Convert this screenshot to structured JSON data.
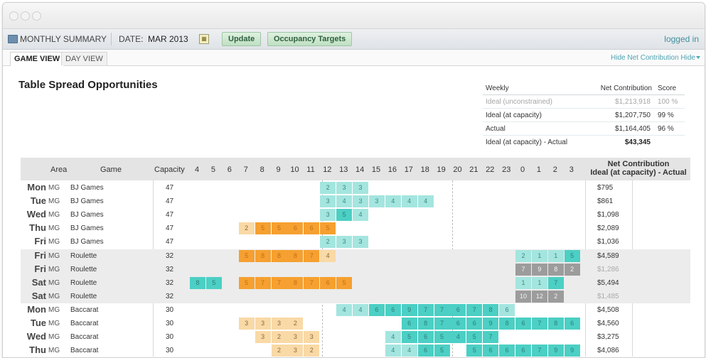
{
  "toolbar": {
    "monthly_summary": "MONTHLY SUMMARY",
    "date_label": "DATE:",
    "date_value": "MAR 2013",
    "update_label": "Update",
    "occupancy_label": "Occupancy Targets",
    "logged_in": "logged in"
  },
  "tabs": [
    {
      "label": "GAME VIEW",
      "active": true
    },
    {
      "label": "DAY VIEW",
      "active": false
    }
  ],
  "hide_links": {
    "hide_net": "Hide Net Contribution",
    "hide": "Hide"
  },
  "title": "Table Spread Opportunities",
  "summary": {
    "headers": [
      "Weekly",
      "Net Contribution",
      "Score"
    ],
    "rows": [
      {
        "label": "Ideal (unconstrained)",
        "value": "$1,213,918",
        "score": "100 %",
        "muted": true
      },
      {
        "label": "Ideal (at capacity)",
        "value": "$1,207,750",
        "score": "99 %",
        "muted": false
      },
      {
        "label": "Actual",
        "value": "$1,164,405",
        "score": "96 %",
        "muted": false
      }
    ],
    "total_label": "Ideal (at capacity) - Actual",
    "total_value": "$43,345"
  },
  "grid": {
    "headers": {
      "area": "Area",
      "game": "Game",
      "capacity": "Capacity",
      "net_line1": "Net Contribution",
      "net_line2": "Ideal (at capacity) - Actual"
    },
    "hours": [
      "4",
      "5",
      "6",
      "7",
      "8",
      "9",
      "10",
      "11",
      "12",
      "13",
      "14",
      "15",
      "16",
      "17",
      "18",
      "19",
      "20",
      "21",
      "22",
      "23",
      "0",
      "1",
      "2",
      "3"
    ],
    "colors": {
      "teal": "#4ccfc4",
      "light_teal": "#a4e5df",
      "orange": "#f5a030",
      "light_orange": "#f9d9a6",
      "gray": "#9c9c9c",
      "light_gray": "#bcbcbc"
    },
    "rows": [
      {
        "day": "Mon",
        "area": "MG",
        "game": "BJ Games",
        "capacity": "47",
        "net": "$795",
        "shade": false,
        "dim": false,
        "cells": [
          [
            8,
            "2",
            "lt"
          ],
          [
            9,
            "3",
            "lt"
          ],
          [
            10,
            "3",
            "lt"
          ]
        ]
      },
      {
        "day": "Tue",
        "area": "MG",
        "game": "BJ Games",
        "capacity": "47",
        "net": "$861",
        "shade": false,
        "dim": false,
        "cells": [
          [
            8,
            "3",
            "lt"
          ],
          [
            9,
            "4",
            "lt"
          ],
          [
            10,
            "3",
            "lt"
          ],
          [
            11,
            "3",
            "lt"
          ],
          [
            12,
            "4",
            "lt"
          ],
          [
            13,
            "4",
            "lt"
          ],
          [
            14,
            "4",
            "lt"
          ]
        ]
      },
      {
        "day": "Wed",
        "area": "MG",
        "game": "BJ Games",
        "capacity": "47",
        "net": "$1,098",
        "shade": false,
        "dim": false,
        "cells": [
          [
            8,
            "3",
            "lt"
          ],
          [
            9,
            "5",
            "t"
          ],
          [
            10,
            "4",
            "lt"
          ]
        ]
      },
      {
        "day": "Thu",
        "area": "MG",
        "game": "BJ Games",
        "capacity": "47",
        "net": "$2,089",
        "shade": false,
        "dim": false,
        "cells": [
          [
            3,
            "2",
            "lo"
          ],
          [
            4,
            "5",
            "o"
          ],
          [
            5,
            "5",
            "o"
          ],
          [
            6,
            "6",
            "o"
          ],
          [
            7,
            "6",
            "o"
          ],
          [
            8,
            "5",
            "o"
          ]
        ]
      },
      {
        "day": "Fri",
        "area": "MG",
        "game": "BJ Games",
        "capacity": "47",
        "net": "$1,036",
        "shade": false,
        "dim": false,
        "cells": [
          [
            8,
            "2",
            "lt"
          ],
          [
            9,
            "3",
            "lt"
          ],
          [
            10,
            "3",
            "lt"
          ]
        ]
      },
      {
        "day": "Fri",
        "area": "MG",
        "game": "Roulette",
        "capacity": "32",
        "net": "$4,589",
        "shade": true,
        "dim": false,
        "cells": [
          [
            3,
            "5",
            "o"
          ],
          [
            4,
            "8",
            "o"
          ],
          [
            5,
            "8",
            "o"
          ],
          [
            6,
            "8",
            "o"
          ],
          [
            7,
            "7",
            "o"
          ],
          [
            8,
            "4",
            "lo"
          ],
          [
            20,
            "2",
            "lt"
          ],
          [
            21,
            "1",
            "lt"
          ],
          [
            22,
            "1",
            "lt"
          ],
          [
            23,
            "5",
            "t"
          ]
        ]
      },
      {
        "day": "Fri",
        "area": "MG",
        "game": "Roulette",
        "capacity": "32",
        "net": "$1,286",
        "shade": true,
        "dim": true,
        "cells": [
          [
            20,
            "7",
            "g"
          ],
          [
            21,
            "9",
            "g"
          ],
          [
            22,
            "8",
            "g"
          ],
          [
            23,
            "2",
            "g"
          ]
        ]
      },
      {
        "day": "Sat",
        "area": "MG",
        "game": "Roulette",
        "capacity": "32",
        "net": "$5,494",
        "shade": true,
        "dim": false,
        "cells": [
          [
            0,
            "8",
            "t"
          ],
          [
            1,
            "5",
            "t"
          ],
          [
            3,
            "5",
            "o"
          ],
          [
            4,
            "7",
            "o"
          ],
          [
            5,
            "7",
            "o"
          ],
          [
            6,
            "8",
            "o"
          ],
          [
            7,
            "7",
            "o"
          ],
          [
            8,
            "6",
            "o"
          ],
          [
            9,
            "5",
            "o"
          ],
          [
            20,
            "1",
            "lt"
          ],
          [
            21,
            "1",
            "lt"
          ],
          [
            22,
            "7",
            "t"
          ]
        ]
      },
      {
        "day": "Sat",
        "area": "MG",
        "game": "Roulette",
        "capacity": "32",
        "net": "$1,485",
        "shade": true,
        "dim": true,
        "cells": [
          [
            20,
            "10",
            "g"
          ],
          [
            21,
            "12",
            "g"
          ],
          [
            22,
            "2",
            "g"
          ]
        ]
      },
      {
        "day": "Mon",
        "area": "MG",
        "game": "Baccarat",
        "capacity": "30",
        "net": "$4,508",
        "shade": false,
        "dim": false,
        "cells": [
          [
            9,
            "4",
            "lt"
          ],
          [
            10,
            "4",
            "lt"
          ],
          [
            11,
            "6",
            "t"
          ],
          [
            12,
            "6",
            "t"
          ],
          [
            13,
            "9",
            "t"
          ],
          [
            14,
            "7",
            "t"
          ],
          [
            15,
            "7",
            "t"
          ],
          [
            16,
            "6",
            "t"
          ],
          [
            17,
            "7",
            "t"
          ],
          [
            18,
            "8",
            "t"
          ],
          [
            19,
            "6",
            "lt"
          ]
        ]
      },
      {
        "day": "Tue",
        "area": "MG",
        "game": "Baccarat",
        "capacity": "30",
        "net": "$4,560",
        "shade": false,
        "dim": false,
        "cells": [
          [
            3,
            "3",
            "lo"
          ],
          [
            4,
            "3",
            "lo"
          ],
          [
            5,
            "3",
            "lo"
          ],
          [
            6,
            "2",
            "lo"
          ],
          [
            13,
            "6",
            "t"
          ],
          [
            14,
            "8",
            "t"
          ],
          [
            15,
            "7",
            "t"
          ],
          [
            16,
            "6",
            "t"
          ],
          [
            17,
            "6",
            "t"
          ],
          [
            18,
            "9",
            "t"
          ],
          [
            19,
            "8",
            "t"
          ],
          [
            20,
            "6",
            "t"
          ],
          [
            21,
            "7",
            "t"
          ],
          [
            22,
            "8",
            "t"
          ],
          [
            23,
            "6",
            "t"
          ]
        ]
      },
      {
        "day": "Wed",
        "area": "MG",
        "game": "Baccarat",
        "capacity": "30",
        "net": "$3,275",
        "shade": false,
        "dim": false,
        "cells": [
          [
            4,
            "3",
            "lo"
          ],
          [
            5,
            "2",
            "lo"
          ],
          [
            6,
            "3",
            "lo"
          ],
          [
            7,
            "3",
            "lo"
          ],
          [
            12,
            "4",
            "lt"
          ],
          [
            13,
            "5",
            "t"
          ],
          [
            14,
            "6",
            "t"
          ],
          [
            15,
            "5",
            "t"
          ],
          [
            16,
            "4",
            "t"
          ],
          [
            17,
            "5",
            "t"
          ],
          [
            18,
            "7",
            "t"
          ]
        ]
      },
      {
        "day": "Thu",
        "area": "MG",
        "game": "Baccarat",
        "capacity": "30",
        "net": "$4,086",
        "shade": false,
        "dim": false,
        "cells": [
          [
            5,
            "2",
            "lo"
          ],
          [
            6,
            "3",
            "lo"
          ],
          [
            7,
            "2",
            "lo"
          ],
          [
            12,
            "4",
            "lt"
          ],
          [
            13,
            "4",
            "lt"
          ],
          [
            14,
            "6",
            "t"
          ],
          [
            15,
            "5",
            "t"
          ],
          [
            17,
            "5",
            "t"
          ],
          [
            18,
            "6",
            "t"
          ],
          [
            19,
            "6",
            "t"
          ],
          [
            20,
            "6",
            "t"
          ],
          [
            21,
            "7",
            "t"
          ],
          [
            22,
            "9",
            "t"
          ],
          [
            23,
            "9",
            "t"
          ]
        ]
      }
    ]
  }
}
